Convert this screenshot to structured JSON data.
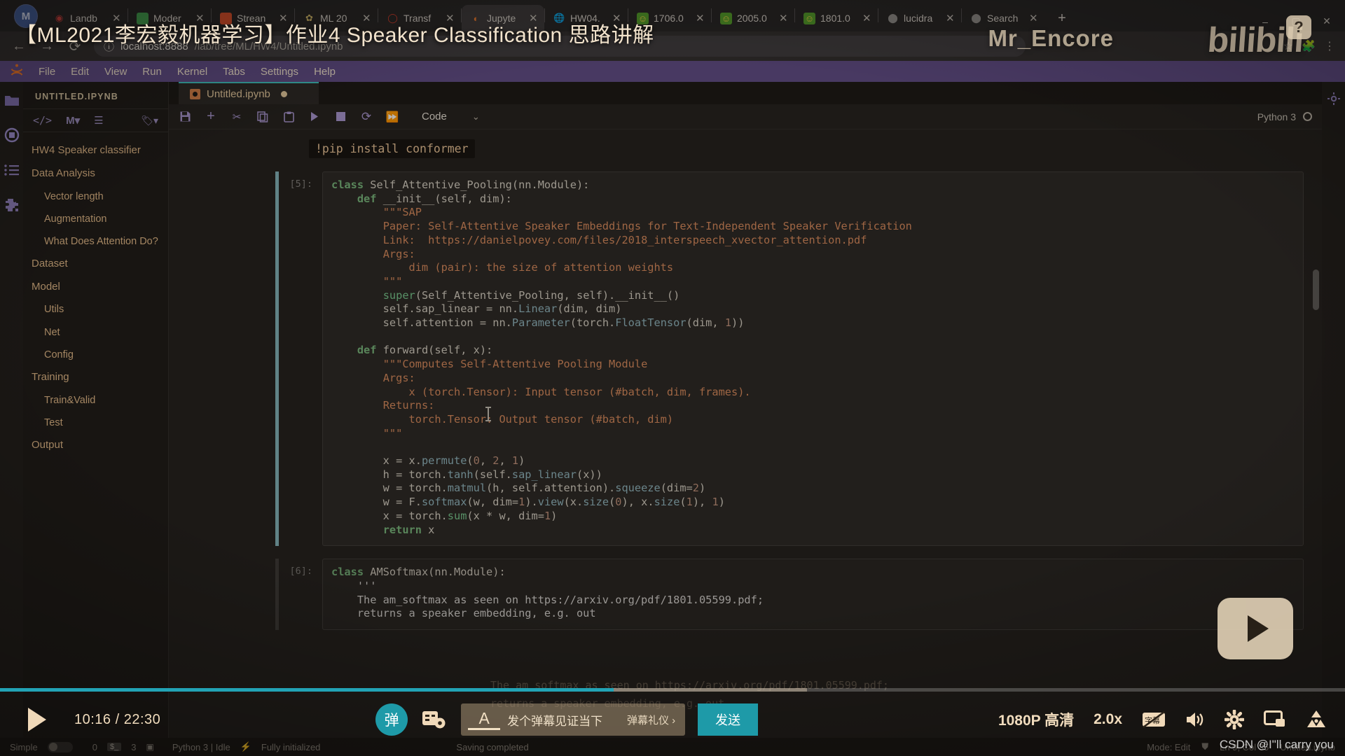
{
  "browser": {
    "profile_initial": "M",
    "tabs": [
      {
        "title": "Landb",
        "icon": "music-icon",
        "icon_color": "#c23b3b",
        "active": false
      },
      {
        "title": "Moder",
        "icon": "bean-icon",
        "icon_color": "#3c9a4e",
        "active": false
      },
      {
        "title": "Strean",
        "icon": "soundcloud-icon",
        "icon_color": "#d14b2a",
        "active": false
      },
      {
        "title": "ML 20",
        "icon": "university-icon",
        "icon_color": "#c8b268",
        "active": false
      },
      {
        "title": "Transf",
        "icon": "huggingface-icon",
        "icon_color": "#d0392b",
        "active": false
      },
      {
        "title": "Jupyte",
        "icon": "jupyter-icon",
        "icon_color": "#e8762c",
        "active": true
      },
      {
        "title": "HW04.",
        "icon": "globe-icon",
        "icon_color": "#9a9a9a",
        "active": false
      },
      {
        "title": "1706.0",
        "icon": "arxiv-icon",
        "icon_color": "#4c9a2a",
        "active": false
      },
      {
        "title": "2005.0",
        "icon": "arxiv-icon",
        "icon_color": "#4c9a2a",
        "active": false
      },
      {
        "title": "1801.0",
        "icon": "arxiv-icon",
        "icon_color": "#4c9a2a",
        "active": false
      },
      {
        "title": "lucidra",
        "icon": "github-icon",
        "icon_color": "#8a8a8a",
        "active": false
      },
      {
        "title": "Search",
        "icon": "github-icon",
        "icon_color": "#8a8a8a",
        "active": false
      }
    ],
    "new_tab_label": "+",
    "close_label": "✕",
    "back_label": "←",
    "forward_label": "→",
    "reload_label": "⟳",
    "url_host": "localhost:8888",
    "url_path": "/lab/tree/ML/HW4/Untitled.ipynb",
    "url_info_icon": "info-icon",
    "window_minimize": "–",
    "window_maximize": "▢",
    "window_close": "✕"
  },
  "jupyter": {
    "menu": [
      "File",
      "Edit",
      "View",
      "Run",
      "Kernel",
      "Tabs",
      "Settings",
      "Help"
    ],
    "left_panel": {
      "title": "UNTITLED.IPYNB",
      "toolbar_icons": [
        "code-brackets-icon",
        "markdown-m-icon",
        "numbered-list-icon",
        "tag-icon"
      ],
      "toc": [
        {
          "label": "HW4 Speaker classifier",
          "level": 1
        },
        {
          "label": "Data Analysis",
          "level": 1
        },
        {
          "label": "Vector length",
          "level": 2
        },
        {
          "label": "Augmentation",
          "level": 2
        },
        {
          "label": "What Does Attention Do?",
          "level": 2
        },
        {
          "label": "Dataset",
          "level": 1
        },
        {
          "label": "Model",
          "level": 1
        },
        {
          "label": "Utils",
          "level": 2
        },
        {
          "label": "Net",
          "level": 2
        },
        {
          "label": "Config",
          "level": 2
        },
        {
          "label": "Training",
          "level": 1
        },
        {
          "label": "Train&Valid",
          "level": 2
        },
        {
          "label": "Test",
          "level": 2
        },
        {
          "label": "Output",
          "level": 1
        }
      ]
    },
    "activity_bar": [
      "file-browser-icon",
      "running-terminals-icon",
      "table-of-contents-icon",
      "extensions-icon"
    ],
    "doc_tab": {
      "label": "Untitled.ipynb",
      "icon": "notebook-icon",
      "dirty": true
    },
    "notebook_toolbar": {
      "icons": [
        "save-icon",
        "insert-cell-icon",
        "cut-icon",
        "copy-icon",
        "paste-icon",
        "run-icon",
        "stop-icon",
        "restart-icon",
        "restart-run-all-icon"
      ],
      "cell_type": "Code",
      "cell_type_chevron": "chevron-down-icon",
      "kernel_name": "Python 3",
      "kernel_status_icon": "kernel-idle-circle"
    },
    "markdown_cell_code": "!pip install conformer",
    "cell5": {
      "prompt": "[5]:",
      "lines": [
        {
          "parts": [
            {
              "t": "class ",
              "c": "kb"
            },
            {
              "t": "Self_Attentive_Pooling",
              "c": "p"
            },
            {
              "t": "(nn.Module):",
              "c": "p"
            }
          ]
        },
        {
          "parts": [
            {
              "t": "    "
            },
            {
              "t": "def ",
              "c": "kb"
            },
            {
              "t": "__init__",
              "c": "p"
            },
            {
              "t": "(self, dim):",
              "c": "p"
            }
          ]
        },
        {
          "parts": [
            {
              "t": "        "
            },
            {
              "t": "\"\"\"SAP",
              "c": "s"
            }
          ]
        },
        {
          "parts": [
            {
              "t": "        "
            },
            {
              "t": "Paper: Self-Attentive Speaker Embeddings for Text-Independent Speaker Verification",
              "c": "s"
            }
          ]
        },
        {
          "parts": [
            {
              "t": "        "
            },
            {
              "t": "Link:  https://danielpovey.com/files/2018_interspeech_xvector_attention.pdf",
              "c": "s"
            }
          ]
        },
        {
          "parts": [
            {
              "t": "        "
            },
            {
              "t": "Args:",
              "c": "s"
            }
          ]
        },
        {
          "parts": [
            {
              "t": "            "
            },
            {
              "t": "dim (pair): the size of attention weights",
              "c": "s"
            }
          ]
        },
        {
          "parts": [
            {
              "t": "        "
            },
            {
              "t": "\"\"\"",
              "c": "s"
            }
          ]
        },
        {
          "parts": [
            {
              "t": "        "
            },
            {
              "t": "super",
              "c": "bi"
            },
            {
              "t": "(Self_Attentive_Pooling, self).__init__()",
              "c": "p"
            }
          ]
        },
        {
          "parts": [
            {
              "t": "        self.sap_linear = nn.",
              "c": "p"
            },
            {
              "t": "Linear",
              "c": "f"
            },
            {
              "t": "(dim, dim)",
              "c": "p"
            }
          ]
        },
        {
          "parts": [
            {
              "t": "        self.attention = nn.",
              "c": "p"
            },
            {
              "t": "Parameter",
              "c": "f"
            },
            {
              "t": "(torch.",
              "c": "p"
            },
            {
              "t": "FloatTensor",
              "c": "f"
            },
            {
              "t": "(dim, ",
              "c": "p"
            },
            {
              "t": "1",
              "c": "n"
            },
            {
              "t": "))",
              "c": "p"
            }
          ]
        },
        {
          "parts": [
            {
              "t": ""
            }
          ]
        },
        {
          "parts": [
            {
              "t": "    "
            },
            {
              "t": "def ",
              "c": "kb"
            },
            {
              "t": "forward",
              "c": "p"
            },
            {
              "t": "(self, x):",
              "c": "p"
            }
          ]
        },
        {
          "parts": [
            {
              "t": "        "
            },
            {
              "t": "\"\"\"Computes Self-Attentive Pooling Module",
              "c": "s"
            }
          ]
        },
        {
          "parts": [
            {
              "t": "        "
            },
            {
              "t": "Args:",
              "c": "s"
            }
          ]
        },
        {
          "parts": [
            {
              "t": "            "
            },
            {
              "t": "x (torch.Tensor): Input tensor (#batch, dim, frames).",
              "c": "s"
            }
          ]
        },
        {
          "parts": [
            {
              "t": "        "
            },
            {
              "t": "Returns:",
              "c": "s"
            }
          ]
        },
        {
          "parts": [
            {
              "t": "            "
            },
            {
              "t": "torch.Tensor: Output tensor (#batch, dim)",
              "c": "s"
            }
          ]
        },
        {
          "parts": [
            {
              "t": "        "
            },
            {
              "t": "\"\"\"",
              "c": "s"
            }
          ]
        },
        {
          "parts": [
            {
              "t": ""
            }
          ]
        },
        {
          "parts": [
            {
              "t": "        x = x.",
              "c": "p"
            },
            {
              "t": "permute",
              "c": "f"
            },
            {
              "t": "(",
              "c": "p"
            },
            {
              "t": "0",
              "c": "n"
            },
            {
              "t": ", ",
              "c": "p"
            },
            {
              "t": "2",
              "c": "n"
            },
            {
              "t": ", ",
              "c": "p"
            },
            {
              "t": "1",
              "c": "n"
            },
            {
              "t": ")",
              "c": "p"
            }
          ]
        },
        {
          "parts": [
            {
              "t": "        h = torch.",
              "c": "p"
            },
            {
              "t": "tanh",
              "c": "f"
            },
            {
              "t": "(self.",
              "c": "p"
            },
            {
              "t": "sap_linear",
              "c": "f"
            },
            {
              "t": "(x))",
              "c": "p"
            }
          ]
        },
        {
          "parts": [
            {
              "t": "        w = torch.",
              "c": "p"
            },
            {
              "t": "matmul",
              "c": "f"
            },
            {
              "t": "(h, self.attention).",
              "c": "p"
            },
            {
              "t": "squeeze",
              "c": "f"
            },
            {
              "t": "(dim=",
              "c": "p"
            },
            {
              "t": "2",
              "c": "n"
            },
            {
              "t": ")",
              "c": "p"
            }
          ]
        },
        {
          "parts": [
            {
              "t": "        w = F.",
              "c": "p"
            },
            {
              "t": "softmax",
              "c": "f"
            },
            {
              "t": "(w, dim=",
              "c": "p"
            },
            {
              "t": "1",
              "c": "n"
            },
            {
              "t": ").",
              "c": "p"
            },
            {
              "t": "view",
              "c": "f"
            },
            {
              "t": "(x.",
              "c": "p"
            },
            {
              "t": "size",
              "c": "f"
            },
            {
              "t": "(",
              "c": "p"
            },
            {
              "t": "0",
              "c": "n"
            },
            {
              "t": "), x.",
              "c": "p"
            },
            {
              "t": "size",
              "c": "f"
            },
            {
              "t": "(",
              "c": "p"
            },
            {
              "t": "1",
              "c": "n"
            },
            {
              "t": "), ",
              "c": "p"
            },
            {
              "t": "1",
              "c": "n"
            },
            {
              "t": ")",
              "c": "p"
            }
          ]
        },
        {
          "parts": [
            {
              "t": "        x = torch.",
              "c": "p"
            },
            {
              "t": "sum",
              "c": "bi"
            },
            {
              "t": "(x * w, dim=",
              "c": "p"
            },
            {
              "t": "1",
              "c": "n"
            },
            {
              "t": ")",
              "c": "p"
            }
          ]
        },
        {
          "parts": [
            {
              "t": "        "
            },
            {
              "t": "return ",
              "c": "kb"
            },
            {
              "t": "x",
              "c": "p"
            }
          ]
        }
      ]
    },
    "cell6": {
      "prompt": "[6]:",
      "line1": "class AMSoftmax(nn.Module):",
      "line2": "    '''",
      "line3": "    The am_softmax as seen on https://arxiv.org/pdf/1801.05599.pdf;",
      "line4": "    returns a speaker embedding, e.g. out"
    },
    "status_bar": {
      "simple_label": "Simple",
      "terminals_count": "0",
      "terminal_icon": "terminal-icon",
      "kernels_count": "3",
      "kernel_icon": "cpu-icon",
      "kernel_status": "Python 3 | Idle",
      "extension_icon": "extension-icon",
      "extension_status": "Fully initialized",
      "saving_status": "Saving completed",
      "mode": "Mode: Edit",
      "shield_icon": "shield-off-icon",
      "position": "Ln 9, Col 35",
      "filename": "Untitled.ipynb"
    }
  },
  "video": {
    "title": "【ML2021李宏毅机器学习】作业4 Speaker Classification 思路讲解",
    "uploader": "Mr_Encore",
    "brand": "bilibili",
    "brand_badge": "?",
    "current_time": "10:16",
    "total_time": "22:30",
    "progress_percent": 45.6,
    "buffered_percent": 60,
    "play_icon": "play-icon",
    "danmaku_toggle_label": "弹",
    "danmaku_settings_icon": "danmaku-settings-icon",
    "danmaku_placeholder": "发个弹幕见证当下",
    "danmaku_etiquette": "弹幕礼仪 ›",
    "danmaku_font_icon": "font-A-icon",
    "send_label": "发送",
    "quality": "1080P 高清",
    "speed": "2.0x",
    "subtitle_icon": "subtitle-off-icon",
    "volume_icon": "volume-icon",
    "settings_icon": "gear-icon",
    "pip_icon": "picture-in-picture-icon",
    "fullscreen_icon": "web-fullscreen-icon",
    "watermark": "CSDN @I\"ll  carry  you"
  }
}
